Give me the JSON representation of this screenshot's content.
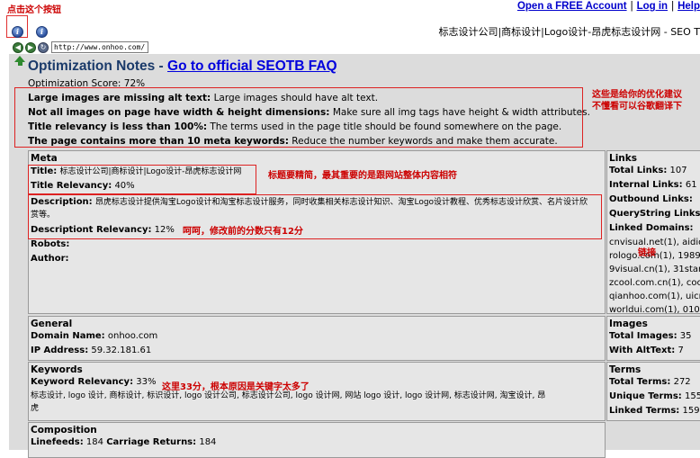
{
  "annotations": {
    "click_button": "点击这个按钮",
    "notes_hint_line1": "这些是给你的优化建议",
    "notes_hint_line2": "不懂看可以谷歌翻译下",
    "title_hint": "标题要精简，最其重要的是跟网站整体内容相符",
    "desc_hint": "呵呵，修改前的分数只有12分",
    "links_hint": "链接",
    "keywords_hint": "这里33分，根本原因是关键字太多了"
  },
  "top_links": {
    "open_account": "Open a FREE Account",
    "login": "Log in",
    "help": "Help",
    "sep": "|"
  },
  "window_title": "标志设计公司|商标设计|Logo设计-昂虎标志设计网 - SEO T",
  "address_bar": {
    "url": "http://www.onhoo.com/"
  },
  "header": {
    "title": "Optimization Notes -",
    "faq_link": "Go to official SEOTB FAQ",
    "score_label": "Optimization Score:",
    "score_value": "72%"
  },
  "notes": [
    {
      "label": "Large images are missing alt text:",
      "text": "Large images should have alt text."
    },
    {
      "label": "Not all images on page have width & height dimensions:",
      "text": "Make sure all img tags have height & width attributes."
    },
    {
      "label": "Title relevancy is less than 100%:",
      "text": "The terms used in the page title should be found somewhere on the page."
    },
    {
      "label": "The page contains more than 10 meta keywords:",
      "text": "Reduce the number keywords and make them accurate."
    }
  ],
  "meta": {
    "heading": "Meta",
    "title_label": "Title:",
    "title_value": "标志设计公司|商标设计|Logo设计-昂虎标志设计网",
    "title_relevancy_label": "Title Relevancy:",
    "title_relevancy_value": "40%",
    "description_label": "Description:",
    "description_value_line1": "昂虎标志设计提供淘宝Logo设计和淘宝标志设计服务，同时收集相关标志设计知识、淘宝Logo设计教程、优秀标志设计欣赏、名片设计欣",
    "description_value_line2": "赏等。",
    "description_relevancy_label": "Descriptiont Relevancy:",
    "description_relevancy_value": "12%",
    "robots_label": "Robots:",
    "author_label": "Author:"
  },
  "links": {
    "heading": "Links",
    "total_label": "Total Links:",
    "total_value": "107",
    "internal_label": "Internal Links:",
    "internal_value": "61",
    "outbound_label": "Outbound Links:",
    "querystring_label": "QueryString Links:",
    "linked_domains_label": "Linked Domains:",
    "linked_domains_values": [
      "cnvisual.net(1), aidid",
      "rologo.com(1), 1989",
      "9visual.cn(1), 31star",
      "zcool.com.cn(1), coc",
      "qianhoo.com(1), uicr",
      "worldui.com(1), 010p"
    ]
  },
  "general": {
    "heading": "General",
    "domain_label": "Domain Name:",
    "domain_value": "onhoo.com",
    "ip_label": "IP Address:",
    "ip_value": "59.32.181.61"
  },
  "images": {
    "heading": "Images",
    "total_label": "Total Images:",
    "total_value": "35",
    "alt_label": "With AltText:",
    "alt_value": "7"
  },
  "keywords": {
    "heading": "Keywords",
    "relevancy_label": "Keyword Relevancy:",
    "relevancy_value": "33%",
    "list_line1": "标志设计, logo 设计, 商标设计, 标识设计, logo 设计公司, 标志设计公司, logo 设计网, 网站 logo 设计, logo 设计网, 标志设计网, 淘宝设计, 昂",
    "list_line2": "虎"
  },
  "terms": {
    "heading": "Terms",
    "total_label": "Total Terms:",
    "total_value": "272",
    "unique_label": "Unique Terms:",
    "unique_value": "155",
    "linked_label": "Linked Terms:",
    "linked_value": "159"
  },
  "composition": {
    "heading": "Composition",
    "linefeeds_label": "Linefeeds:",
    "linefeeds_value": "184",
    "cr_label": "Carriage Returns:",
    "cr_value": "184"
  },
  "colors": {
    "annotation_red": "#cc0000",
    "link_blue": "#0000cc",
    "panel_gray": "#dcdcdc",
    "title_navy": "#1a3a6a"
  }
}
